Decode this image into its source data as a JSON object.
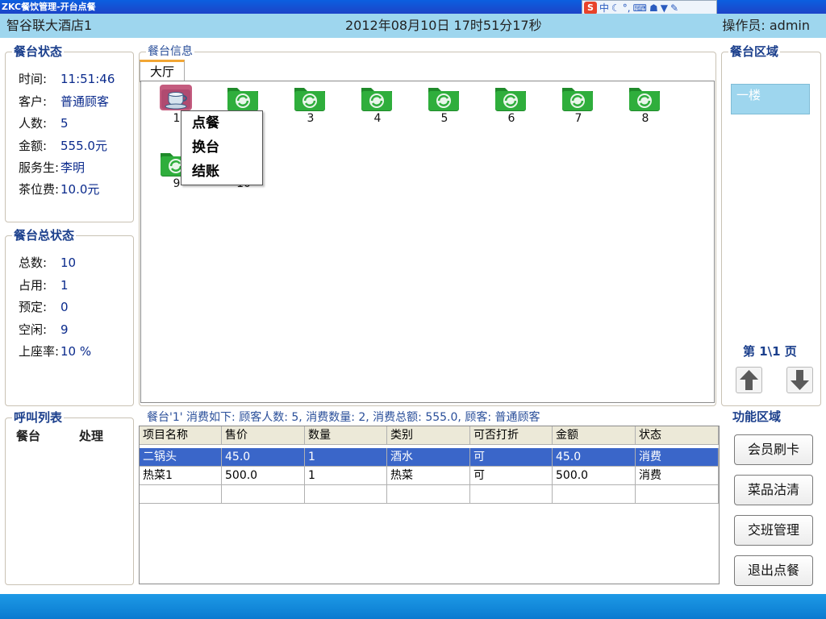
{
  "window": {
    "title": "ZKC餐饮管理-开台点餐"
  },
  "ime": {
    "logo": "S",
    "mode": "中"
  },
  "header": {
    "hotel": "智谷联大酒店1",
    "datetime": "2012年08月10日  17时51分17秒",
    "operator_label": "操作员:",
    "operator": "admin"
  },
  "table_status": {
    "legend": "餐台状态",
    "rows": [
      {
        "k": "时间:",
        "v": "11:51:46"
      },
      {
        "k": "客户:",
        "v": "普通顾客"
      },
      {
        "k": "人数:",
        "v": "5"
      },
      {
        "k": "金额:",
        "v": "555.0元"
      },
      {
        "k": "服务生:",
        "v": "李明"
      },
      {
        "k": "茶位费:",
        "v": "10.0元"
      }
    ]
  },
  "summary": {
    "legend": "餐台总状态",
    "rows": [
      {
        "k": "总数:",
        "v": "10"
      },
      {
        "k": "占用:",
        "v": "1"
      },
      {
        "k": "预定:",
        "v": "0"
      },
      {
        "k": "空闲:",
        "v": "9"
      },
      {
        "k": "上座率:",
        "v": "10 %"
      }
    ]
  },
  "table_info": {
    "legend": "餐台信息",
    "tab": "大厅",
    "tables": [
      "1",
      "2",
      "3",
      "4",
      "5",
      "6",
      "7",
      "8",
      "9",
      "10"
    ],
    "occupied": "1"
  },
  "context_menu": [
    "点餐",
    "换台",
    "结账"
  ],
  "area": {
    "legend": "餐台区域",
    "zones": [
      "一楼"
    ],
    "page": "第 1\\1 页"
  },
  "call_list": {
    "legend": "呼叫列表",
    "col1": "餐台",
    "col2": "处理"
  },
  "orders": {
    "caption": "餐台'1' 消费如下: 顾客人数: 5,  消费数量: 2,  消费总额: 555.0,   顾客: 普通顾客",
    "columns": [
      "项目名称",
      "售价",
      "数量",
      "类别",
      "可否打折",
      "金额",
      "状态"
    ],
    "rows": [
      [
        "二锅头",
        "45.0",
        "1",
        "酒水",
        "可",
        "45.0",
        "消费"
      ],
      [
        "热菜1",
        "500.0",
        "1",
        "热菜",
        "可",
        "500.0",
        "消费"
      ]
    ]
  },
  "functions": {
    "legend": "功能区域",
    "buttons": [
      "会员刷卡",
      "菜品沽清",
      "交班管理",
      "退出点餐"
    ]
  },
  "colors": {
    "accent": "#9ed6ee",
    "selection": "#3a66c9",
    "titlebar": "#0b5fe0",
    "status_bar": "#0a7ad0"
  }
}
